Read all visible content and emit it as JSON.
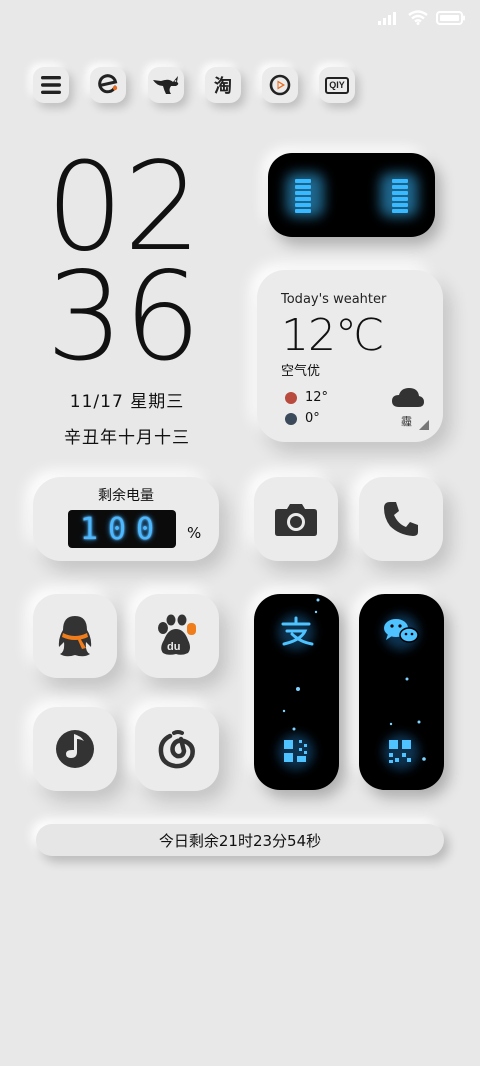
{
  "status_bar": {
    "signal_icon": "signal-icon",
    "wifi_icon": "wifi-icon",
    "battery_icon": "battery-icon"
  },
  "top_apps": [
    {
      "name": "menu-icon"
    },
    {
      "name": "browser-icon"
    },
    {
      "name": "kangaroo-app-icon"
    },
    {
      "name": "taobao-icon",
      "label": "淘"
    },
    {
      "name": "video-play-icon"
    },
    {
      "name": "iqiyi-icon",
      "label": "QIY"
    }
  ],
  "clock": {
    "hour": "02",
    "minute": "36"
  },
  "date": {
    "gregorian": "11/17 星期三",
    "lunar": "辛丑年十月十三"
  },
  "weather": {
    "title": "Today's weahter",
    "temperature": "12℃",
    "air_quality": "空气优",
    "high": "12°",
    "low": "0°",
    "condition_label": "霾",
    "high_color": "#b94a3e",
    "low_color": "#3a4a5a"
  },
  "battery": {
    "label": "剩余电量",
    "value": "100",
    "unit": "%"
  },
  "countdown": {
    "text": "今日剩余21时23分54秒"
  },
  "accent": {
    "glow": "#39b9ff"
  }
}
